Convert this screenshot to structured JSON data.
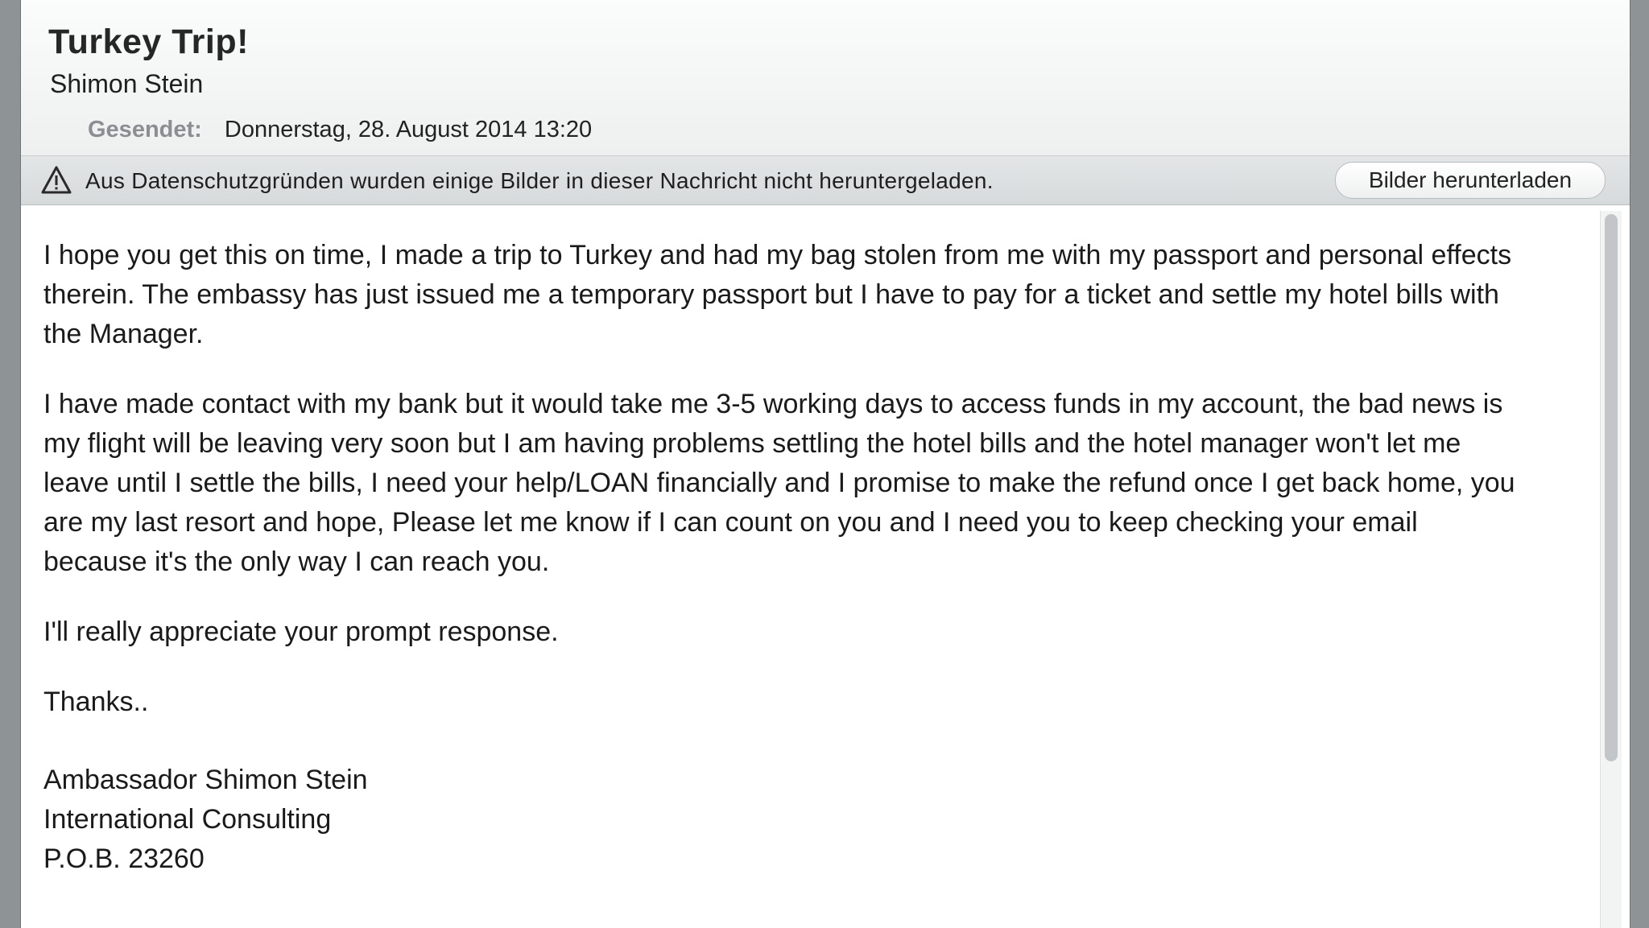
{
  "message": {
    "subject": "Turkey Trip!",
    "sender": "Shimon Stein",
    "sent_label": "Gesendet:",
    "sent_value": "Donnerstag, 28. August 2014 13:20"
  },
  "banner": {
    "icon": "warning-icon",
    "text": "Aus Datenschutzgründen wurden einige Bilder in dieser Nachricht nicht heruntergeladen.",
    "button_label": "Bilder herunterladen"
  },
  "body": {
    "paragraphs": [
      "I hope you get this on time, I made a trip to Turkey and had my bag stolen from me with my passport and personal effects therein. The embassy has just issued me a temporary passport but I have to pay for a ticket and settle my hotel bills with the Manager.",
      "I have made contact with my bank but it would take me 3-5 working days to access funds in my account, the bad news is my flight will be leaving very soon but I am having problems settling the hotel bills and the hotel manager won't let me leave until I settle the bills, I need your help/LOAN financially and I promise to make the refund once I get back home, you are my last resort and hope, Please let me know if I can count on you and I need you to keep checking your email because it's the only way I can reach you.",
      "I'll really appreciate your prompt response."
    ],
    "closing": "Thanks..",
    "signature": [
      "Ambassador Shimon Stein",
      "International Consulting",
      "P.O.B. 23260"
    ]
  },
  "colors": {
    "header_background": "#f3f4f4",
    "banner_background": "#dcdfe0",
    "text": "#1a1a1a",
    "label_gray": "#8b8f91"
  }
}
